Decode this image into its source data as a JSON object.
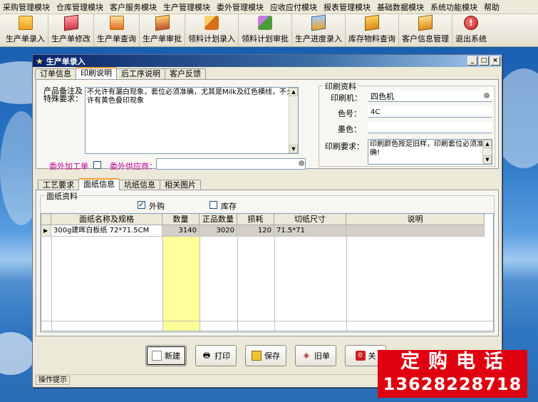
{
  "menubar": {
    "items": [
      "采购管理模块",
      "仓库管理模块",
      "客户服务模块",
      "生产管理模块",
      "委外管理模块",
      "应收应付模块",
      "报表管理模块",
      "基础数据模块",
      "系统功能模块",
      "帮助"
    ]
  },
  "toolbar": {
    "buttons": [
      {
        "label": "生产单录入",
        "icon": "document-add-icon"
      },
      {
        "label": "生产单修改",
        "icon": "document-edit-icon"
      },
      {
        "label": "生产单查询",
        "icon": "document-search-icon"
      },
      {
        "label": "生产单审批",
        "icon": "approve-icon"
      },
      {
        "label": "领料计划录入",
        "icon": "pen-icon"
      },
      {
        "label": "领料计划审批",
        "icon": "pencil-approve-icon"
      },
      {
        "label": "生产进度录入",
        "icon": "progress-icon"
      },
      {
        "label": "库存物料查询",
        "icon": "box-icon"
      },
      {
        "label": "客户信息管理",
        "icon": "customer-icon"
      },
      {
        "label": "退出系统",
        "icon": "exit-icon"
      }
    ]
  },
  "window": {
    "title": "生产单录入",
    "controls": {
      "minimize": "_",
      "maximize": "□",
      "close": "×"
    }
  },
  "upper_tabs": [
    "订单信息",
    "印刷说明",
    "后工序说明",
    "客户反馈"
  ],
  "print_notes": {
    "remarks_label": "产品备注及特殊要求：",
    "remarks_text": "不允许有漏白现象，套位必须准确，尤其是Milk及红色横线，不允许有黄色叠印现象",
    "outsource_label": "委外加工单",
    "outsource_checked": false,
    "supplier_label": "委外供应商：",
    "supplier_value": ""
  },
  "print_info": {
    "group_title": "印刷资料",
    "printer_label": "印刷机：",
    "printer_value": "四色机",
    "color_label": "色号：",
    "color_value": "4C",
    "ink_label": "墨色：",
    "ink_value": "",
    "requirement_label": "印刷要求：",
    "requirement_value": "印刷颜色按足旧样，印刷套位必须准确!"
  },
  "lower_tabs": [
    "工艺要求",
    "面纸信息",
    "坑纸信息",
    "相关图片"
  ],
  "paper_info": {
    "group_title": "面纸资料",
    "purchase_label": "外购",
    "purchase_checked": true,
    "stock_label": "库存",
    "stock_checked": false,
    "columns": [
      "面纸名称及规格",
      "数量",
      "正品数量",
      "损耗",
      "切纸尺寸",
      "说明"
    ],
    "rows": [
      {
        "name": "300g建晖白板纸  72*71.5CM",
        "qty": "3140",
        "good_qty": "3020",
        "loss": "120",
        "cut_size": "71.5*71",
        "note": ""
      }
    ]
  },
  "actions": {
    "new": "新建",
    "print": "打印",
    "save": "保存",
    "old": "旧单",
    "close": "关"
  },
  "status": {
    "hint": "操作提示"
  },
  "promo": {
    "line1": "定购电话",
    "line2": "13628228718"
  }
}
